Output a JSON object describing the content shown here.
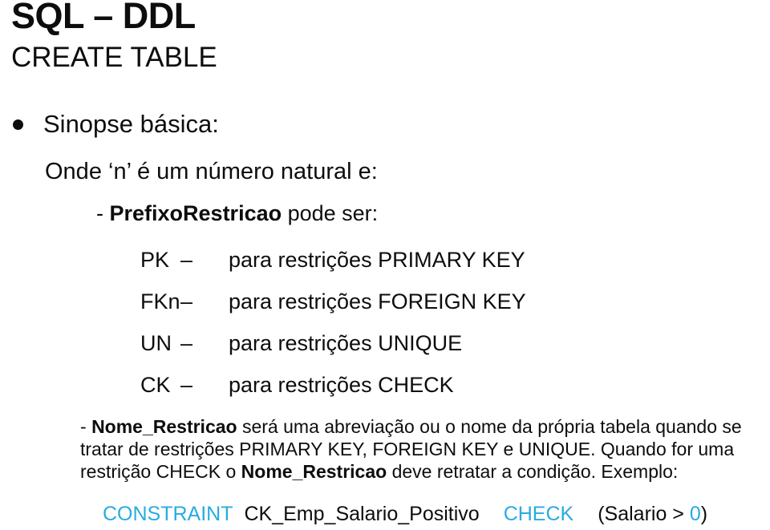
{
  "slide": {
    "title_main": "SQL – DDL",
    "title_sub": "CREATE TABLE",
    "bullet_label": "Sinopse básica:",
    "line_onde": "Onde ‘n’ é um número natural e:",
    "prefixo_dash": "- ",
    "prefixo_bold": "PrefixoRestricao",
    "prefixo_rest": " pode ser:",
    "prefix_rows": [
      {
        "code": "PK",
        "dash": "–",
        "desc": "para restrições PRIMARY KEY"
      },
      {
        "code": "FKn",
        "dash": "–",
        "desc": "para restrições FOREIGN KEY"
      },
      {
        "code": "UN",
        "dash": "–",
        "desc": "para restrições UNIQUE"
      },
      {
        "code": "CK",
        "dash": "–",
        "desc": "para restrições CHECK"
      }
    ],
    "paragraph": {
      "p1_dash": "- ",
      "p1_bold": "Nome_Restricao",
      "p1_text": " será uma abreviação ou o nome da própria tabela quando se tratar de restrições PRIMARY KEY, FOREIGN KEY e UNIQUE. Quando for uma restrição CHECK o ",
      "p2_bold": "Nome_Restricao",
      "p2_text": " deve retratar a condição. Exemplo:"
    },
    "code": {
      "kw_constraint": "CONSTRAINT",
      "constraint_name": "CK_Emp_Salario_Positivo",
      "kw_check": "CHECK",
      "expr_open": "(Salario > ",
      "expr_value": "0",
      "expr_close": ")"
    },
    "colors": {
      "keyword": "#29abe2",
      "text": "#0d0d0d",
      "background": "#ffffff"
    }
  }
}
